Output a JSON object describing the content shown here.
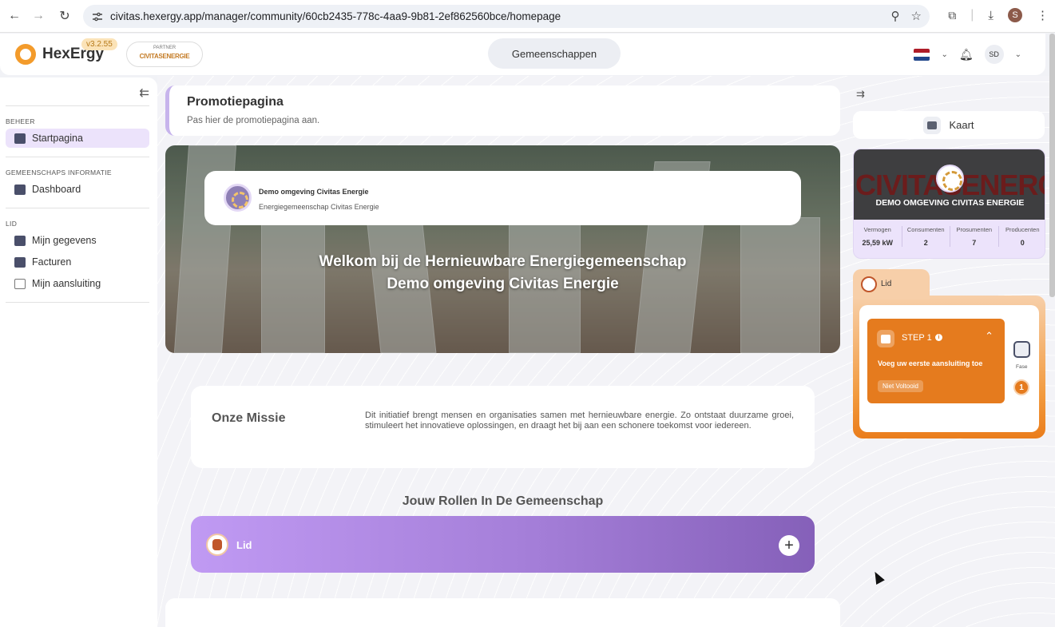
{
  "browser": {
    "url": "civitas.hexergy.app/manager/community/60cb2435-778c-4aa9-9b81-2ef862560bce/homepage",
    "profile_initial": "S"
  },
  "header": {
    "brand": "HexErgy",
    "version": "v3.2.55",
    "partner_label": "PARTNER",
    "partner_name": "CIVITASENERGIE",
    "center_tab": "Gemeenschappen",
    "avatar_initials": "SD"
  },
  "sidebar": {
    "sections": [
      {
        "title": "BEHEER",
        "items": [
          {
            "label": "Startpagina",
            "active": true
          }
        ]
      },
      {
        "title": "GEMEENSCHAPS INFORMATIE",
        "items": [
          {
            "label": "Dashboard"
          }
        ]
      },
      {
        "title": "LID",
        "items": [
          {
            "label": "Mijn gegevens"
          },
          {
            "label": "Facturen"
          },
          {
            "label": "Mijn aansluiting"
          }
        ]
      }
    ]
  },
  "main": {
    "page_title": "Promotiepagina",
    "page_subtitle": "Pas hier de promotiepagina aan.",
    "hero": {
      "card_title": "Demo omgeving Civitas Energie",
      "card_subtitle": "Energiegemeenschap Civitas Energie",
      "line1": "Welkom bij de Hernieuwbare Energiegemeenschap",
      "line2": "Demo omgeving Civitas Energie"
    },
    "mission": {
      "title": "Onze Missie",
      "text": "Dit initiatief brengt mensen en organisaties samen met hernieuwbare energie. Zo ontstaat duurzame groei, stimuleert het innovatieve oplossingen, en draagt het bij aan een schonere toekomst voor iedereen."
    },
    "roles_title": "Jouw Rollen In De Gemeenschap",
    "role_label": "Lid",
    "role_add": "+"
  },
  "right_panel": {
    "kaart_label": "Kaart",
    "community_banner_text": "CIVITASENERGI",
    "community_name": "DEMO OMGEVING CIVITAS ENERGIE",
    "stats": [
      {
        "label": "Vermogen",
        "value": "25,59 kW"
      },
      {
        "label": "Consumenten",
        "value": "2"
      },
      {
        "label": "Prosumenten",
        "value": "7"
      },
      {
        "label": "Producenten",
        "value": "0"
      }
    ],
    "lid_tab": "Lid",
    "step": {
      "label": "STEP 1",
      "info": "i",
      "description": "Voeg uw eerste aansluiting toe",
      "status": "Niet Voltooid"
    },
    "fase_label": "Fase",
    "fase_number": "1"
  }
}
